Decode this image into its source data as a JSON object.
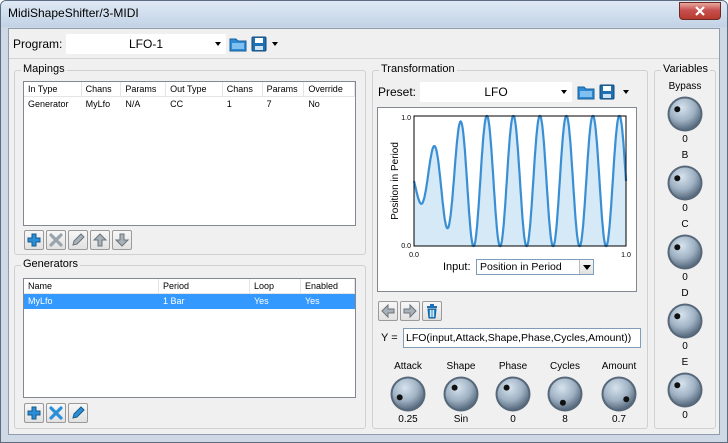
{
  "window": {
    "title": "MidiShapeShifter/3-MIDI"
  },
  "program": {
    "label": "Program:",
    "value": "LFO-1"
  },
  "mappings": {
    "title": "Mapings",
    "columns": [
      "In Type",
      "Chans",
      "Params",
      "Out Type",
      "Chans",
      "Params",
      "Override"
    ],
    "rows": [
      [
        "Generator",
        "MyLfo",
        "N/A",
        "CC",
        "1",
        "7",
        "No"
      ]
    ]
  },
  "generators": {
    "title": "Generators",
    "columns": [
      "Name",
      "Period",
      "Loop",
      "Enabled"
    ],
    "rows": [
      [
        "MyLfo",
        "1 Bar",
        "Yes",
        "Yes"
      ]
    ]
  },
  "transformation": {
    "title": "Transformation",
    "preset_label": "Preset:",
    "preset_value": "LFO",
    "input_label": "Input:",
    "input_value": "Position in Period",
    "formula_label": "Y =",
    "formula_value": "LFO(input,Attack,Shape,Phase,Cycles,Amount))"
  },
  "chart_data": {
    "type": "area",
    "ylabel": "Position in Period",
    "xlim": [
      0.0,
      1.0
    ],
    "ylim": [
      0.0,
      1.0
    ],
    "x_ticks": [
      "0.0",
      "1.0"
    ],
    "y_ticks": [
      "0.0",
      "1.0"
    ],
    "amplitude_envelope_attack": 0.25,
    "cycles": 8,
    "amount": 0.7,
    "center": 0.5,
    "line_color": "#3a8fd4",
    "fill_color": "#d5e9f6"
  },
  "knobs": [
    {
      "name": "Attack",
      "value": "0.25",
      "level": 0.25
    },
    {
      "name": "Shape",
      "value": "Sin",
      "level": 0.0
    },
    {
      "name": "Phase",
      "value": "0",
      "level": 0.0
    },
    {
      "name": "Cycles",
      "value": "8",
      "level": 0.45
    },
    {
      "name": "Amount",
      "value": "0.7",
      "level": 0.7
    }
  ],
  "variables": {
    "title": "Variables",
    "items": [
      {
        "name": "Bypass",
        "value": "0"
      },
      {
        "name": "B",
        "value": "0"
      },
      {
        "name": "C",
        "value": "0"
      },
      {
        "name": "D",
        "value": "0"
      },
      {
        "name": "E",
        "value": "0"
      }
    ]
  },
  "icons": {
    "folder": "folder-open-icon",
    "save": "floppy-disk-icon",
    "add": "plus-icon",
    "delete": "x-icon",
    "edit": "pencil-icon",
    "up": "arrow-up-icon",
    "down": "arrow-down-icon",
    "undo": "arrow-left-icon",
    "redo": "arrow-right-icon",
    "trash": "trash-icon"
  }
}
